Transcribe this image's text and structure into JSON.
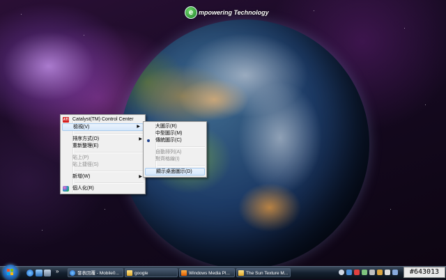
{
  "desktop": {
    "brand_letter": "e",
    "brand_text": "mpowering Technology"
  },
  "context_menu": {
    "items": [
      {
        "label": "Catalyst(TM) Control Center",
        "icon": "ati-icon"
      },
      {
        "label": "檢視(V)",
        "submenu": true,
        "highlighted": true
      },
      {
        "label": "排序方式(O)",
        "submenu": true
      },
      {
        "label": "重新整理(E)"
      },
      {
        "label": "貼上(P)",
        "disabled": true
      },
      {
        "label": "貼上捷徑(S)",
        "disabled": true
      },
      {
        "label": "新增(W)",
        "submenu": true
      },
      {
        "label": "個人化(R)",
        "icon": "personalize-icon"
      }
    ],
    "ati_badge": "ATI"
  },
  "view_submenu": {
    "items": [
      {
        "label": "大圖示(R)"
      },
      {
        "label": "中型圖示(M)"
      },
      {
        "label": "傳統圖示(C)",
        "selected": true
      },
      {
        "label": "自動排列(A)",
        "disabled": true
      },
      {
        "label": "對齊格線(I)",
        "disabled": true
      },
      {
        "label": "顯示桌面圖示(D)",
        "highlighted": true
      }
    ]
  },
  "taskbar": {
    "quick_launch_more": "»",
    "tasks": [
      {
        "label": "發表回覆 - Mobile0...",
        "icon": "ie-icon"
      },
      {
        "label": "google",
        "icon": "folder-icon"
      },
      {
        "label": "Windows Media Pl...",
        "icon": "media-player-icon"
      },
      {
        "label": "The Sun Texture M...",
        "icon": "folder-icon"
      }
    ],
    "language": "",
    "tray_badge": "#643013"
  },
  "colors": {
    "menu_bg": "#f0f0f0",
    "highlight": "#d5e7fb",
    "taskbar": "#14202e"
  }
}
